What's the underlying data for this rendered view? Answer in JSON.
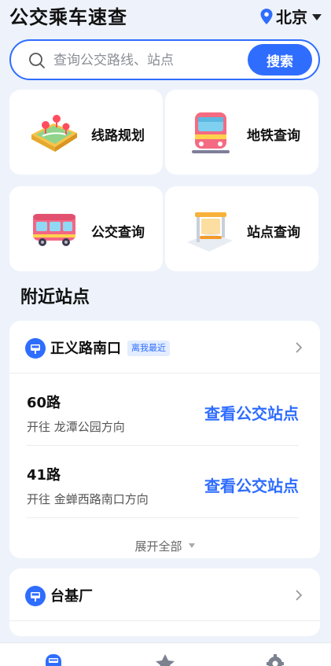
{
  "header": {
    "title": "公交乘车速查",
    "city": "北京"
  },
  "search": {
    "placeholder": "查询公交路线、站点",
    "button": "搜索"
  },
  "features": [
    {
      "label": "线路规划",
      "icon": "map-illustration-icon"
    },
    {
      "label": "地铁查询",
      "icon": "subway-train-icon"
    },
    {
      "label": "公交查询",
      "icon": "bus-icon"
    },
    {
      "label": "站点查询",
      "icon": "bus-stop-icon"
    }
  ],
  "nearby": {
    "title": "附近站点",
    "stops": [
      {
        "name": "正义路南口",
        "badge": "离我最近",
        "routes": [
          {
            "name": "60路",
            "direction": "开往 龙潭公园方向",
            "link": "查看公交站点"
          },
          {
            "name": "41路",
            "direction": "开往 金蝉西路南口方向",
            "link": "查看公交站点"
          }
        ],
        "expand": "展开全部"
      },
      {
        "name": "台基厂"
      }
    ]
  },
  "nav": [
    "bus-home-icon",
    "star-icon",
    "gear-icon"
  ],
  "colors": {
    "accent": "#2f6dff",
    "background": "#eef3fb"
  }
}
